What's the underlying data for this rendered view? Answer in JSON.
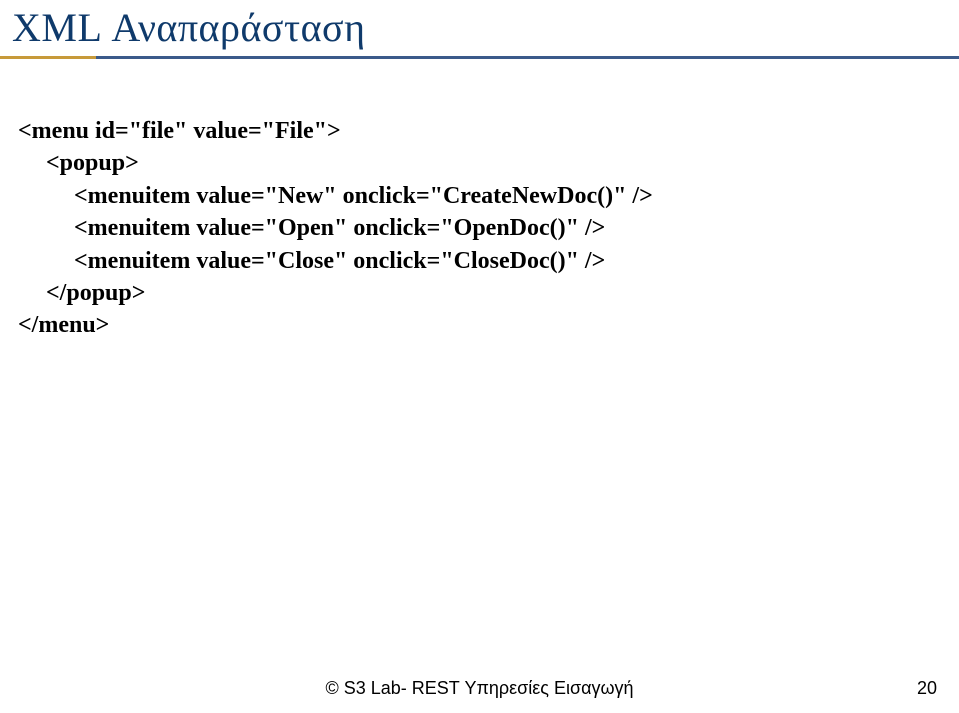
{
  "title": "XML Αναπαράσταση",
  "code": {
    "line1": "<menu id=\"file\" value=\"File\">",
    "line2": "<popup>",
    "line3": "<menuitem value=\"New\" onclick=\"CreateNewDoc()\" />",
    "line4": "<menuitem value=\"Open\" onclick=\"OpenDoc()\" />",
    "line5": "<menuitem value=\"Close\" onclick=\"CloseDoc()\" />",
    "line6": "</popup>",
    "line7": "</menu>"
  },
  "footer": "© S3 Lab- REST Υπηρεσίες Εισαγωγή",
  "page": "20"
}
